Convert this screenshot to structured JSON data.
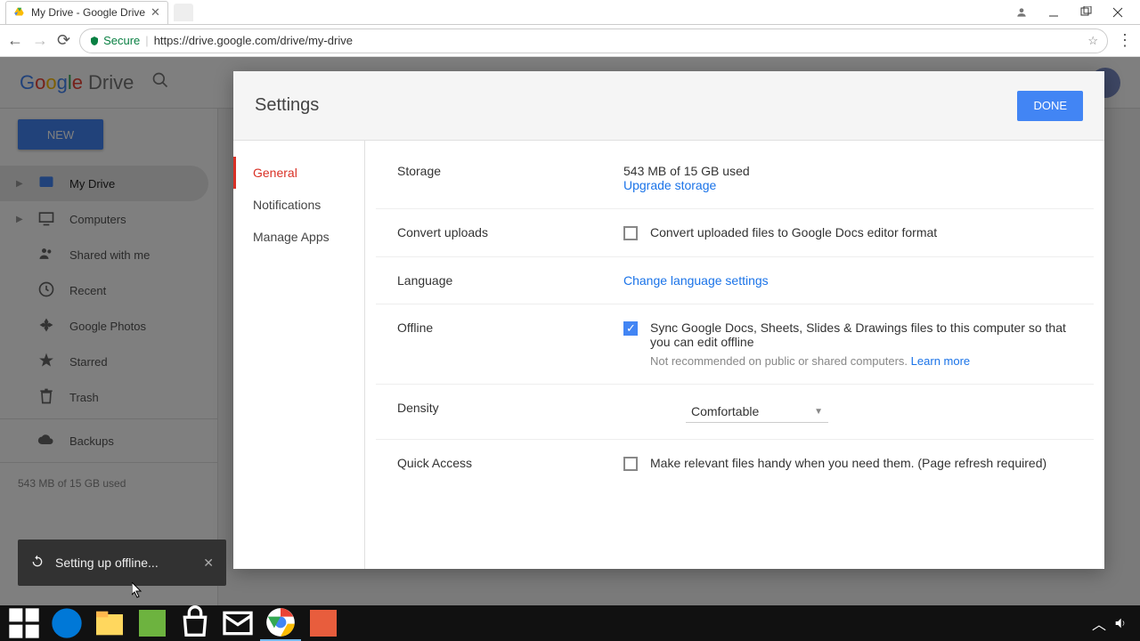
{
  "browser": {
    "tab_title": "My Drive - Google Drive",
    "secure_label": "Secure",
    "url": "https://drive.google.com/drive/my-drive"
  },
  "drive": {
    "logo_suffix": "Drive",
    "new_button": "NEW",
    "nav": {
      "my_drive": "My Drive",
      "computers": "Computers",
      "shared": "Shared with me",
      "recent": "Recent",
      "photos": "Google Photos",
      "starred": "Starred",
      "trash": "Trash",
      "backups": "Backups"
    },
    "storage_line": "543 MB of 15 GB used"
  },
  "modal": {
    "title": "Settings",
    "done": "DONE",
    "nav": {
      "general": "General",
      "notifications": "Notifications",
      "manage_apps": "Manage Apps"
    },
    "storage": {
      "label": "Storage",
      "used": "543 MB of 15 GB used",
      "upgrade": "Upgrade storage"
    },
    "convert": {
      "label": "Convert uploads",
      "text": "Convert uploaded files to Google Docs editor format"
    },
    "language": {
      "label": "Language",
      "link": "Change language settings"
    },
    "offline": {
      "label": "Offline",
      "text": "Sync Google Docs, Sheets, Slides & Drawings files to this computer so that you can edit offline",
      "hint": "Not recommended on public or shared computers.",
      "learn": "Learn more"
    },
    "density": {
      "label": "Density",
      "value": "Comfortable"
    },
    "quick_access": {
      "label": "Quick Access",
      "text": "Make relevant files handy when you need them. (Page refresh required)"
    }
  },
  "toast": {
    "text": "Setting up offline..."
  }
}
